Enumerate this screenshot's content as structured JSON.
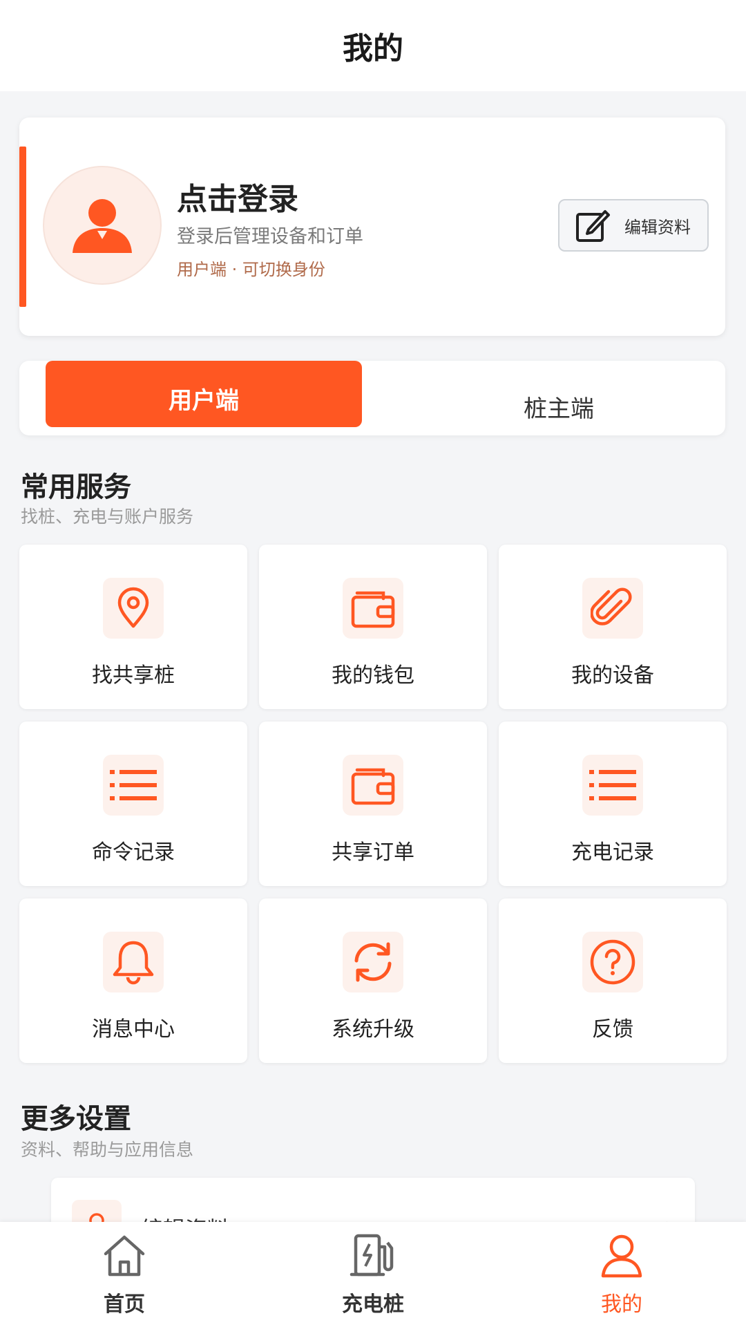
{
  "header": {
    "title": "我的"
  },
  "profile": {
    "login_title": "点击登录",
    "login_subtitle": "登录后管理设备和订单",
    "role_text": "用户端 · 可切换身份",
    "edit_button_label": "编辑资料"
  },
  "role_switch": {
    "active_label": "用户端",
    "inactive_label": "桩主端"
  },
  "services": {
    "title": "常用服务",
    "subtitle": "找桩、充电与账户服务",
    "items": [
      {
        "label": "找共享桩",
        "icon": "location-pin-icon"
      },
      {
        "label": "我的钱包",
        "icon": "wallet-icon"
      },
      {
        "label": "我的设备",
        "icon": "paperclip-icon"
      },
      {
        "label": "命令记录",
        "icon": "list-icon"
      },
      {
        "label": "共享订单",
        "icon": "wallet-icon"
      },
      {
        "label": "充电记录",
        "icon": "list-icon"
      },
      {
        "label": "消息中心",
        "icon": "bell-icon"
      },
      {
        "label": "系统升级",
        "icon": "refresh-icon"
      },
      {
        "label": "反馈",
        "icon": "help-circle-icon"
      }
    ]
  },
  "more_settings": {
    "title": "更多设置",
    "subtitle": "资料、帮助与应用信息",
    "items": [
      {
        "label": "编辑资料",
        "icon": "user-icon"
      }
    ]
  },
  "tabbar": {
    "items": [
      {
        "label": "首页",
        "icon": "home-icon"
      },
      {
        "label": "充电桩",
        "icon": "charging-station-icon"
      },
      {
        "label": "我的",
        "icon": "user-icon"
      }
    ],
    "active_index": 2
  },
  "colors": {
    "accent": "#ff5722",
    "background": "#f4f5f7"
  }
}
